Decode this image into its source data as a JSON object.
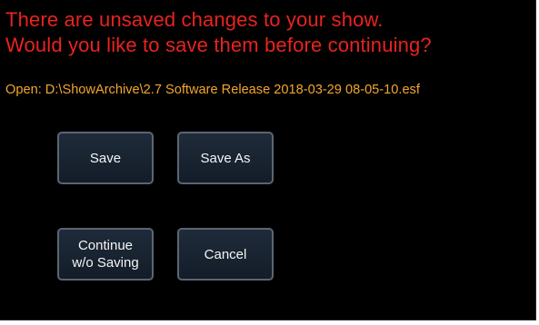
{
  "dialog": {
    "message_line_1": "There are unsaved changes to your show.",
    "message_line_2": "Would you like to save them before continuing?",
    "open_path": "Open:  D:\\ShowArchive\\2.7 Software Release 2018-03-29 08-05-10.esf"
  },
  "buttons": {
    "save": "Save",
    "save_as": "Save As",
    "continue_line_1": "Continue",
    "continue_line_2": "w/o Saving",
    "cancel": "Cancel"
  },
  "colors": {
    "background": "#000000",
    "message_text": "#e8231f",
    "path_text": "#f2a62e",
    "button_fill": "#1a2431",
    "button_border": "#5b6572",
    "button_text": "#f4f4f4"
  }
}
